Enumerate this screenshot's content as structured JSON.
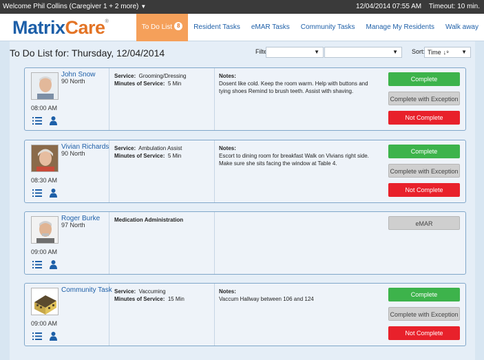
{
  "topbar": {
    "welcome": "Welcome Phil Collins (Caregiver 1 + 2 more)",
    "datetime": "12/04/2014 07:55 AM",
    "timeout": "Timeout: 10 min."
  },
  "header": {
    "logo_matrix": "Matrix",
    "logo_care": "Care",
    "tabs": [
      {
        "label": "To Do List",
        "badge": "8"
      },
      {
        "label": "Resident Tasks"
      },
      {
        "label": "eMAR Tasks"
      },
      {
        "label": "Community Tasks"
      },
      {
        "label": "Manage My Residents"
      },
      {
        "label": "Walk away"
      }
    ]
  },
  "page": {
    "heading": "To Do List for: Thursday, 12/04/2014",
    "filter_label": "Filter:",
    "filter1_value": "",
    "filter2_value": "",
    "sort_label": "Sort:",
    "sort_value": "Time"
  },
  "tasks": [
    {
      "name": "John Snow",
      "room": "90 North",
      "time": "08:00 AM",
      "service_label": "Service:",
      "service": "Grooming/Dressing",
      "minutes_label": "Minutes of Service:",
      "minutes": "5 Min",
      "notes_label": "Notes:",
      "notes": "Dosent like cold. Keep the room warm. Help with buttons and tying shoes Remind to brush teeth. Assist with shaving.",
      "btn_complete": "Complete",
      "btn_exception": "Complete with Exception",
      "btn_not": "Not Complete"
    },
    {
      "name": "Vivian Richards",
      "room": "90 North",
      "time": "08:30 AM",
      "service_label": "Service:",
      "service": "Ambulation Assist",
      "minutes_label": "Minutes of Service:",
      "minutes": "5 Min",
      "notes_label": "Notes:",
      "notes": "Escort to dining room for breakfast Walk on Vivians right side. Make sure she sits facing the window at Table 4.",
      "btn_complete": "Complete",
      "btn_exception": "Complete with Exception",
      "btn_not": "Not Complete"
    },
    {
      "name": "Roger Burke",
      "room": "97 North",
      "time": "09:00 AM",
      "service": "Medication Administration",
      "btn_emar": "eMAR"
    },
    {
      "name": "Community Task",
      "time": "09:00 AM",
      "service_label": "Service:",
      "service": "Vaccuming",
      "minutes_label": "Minutes of Service:",
      "minutes": "15 Min",
      "notes_label": "Notes:",
      "notes": "Vaccum Hallway between 106 and 124",
      "btn_complete": "Complete",
      "btn_exception": "Complete with Exception",
      "btn_not": "Not Complete"
    }
  ],
  "colors": {
    "brand_blue": "#1d5fa8",
    "brand_orange": "#e37426",
    "complete_green": "#3db34b",
    "not_complete_red": "#e8212b"
  }
}
